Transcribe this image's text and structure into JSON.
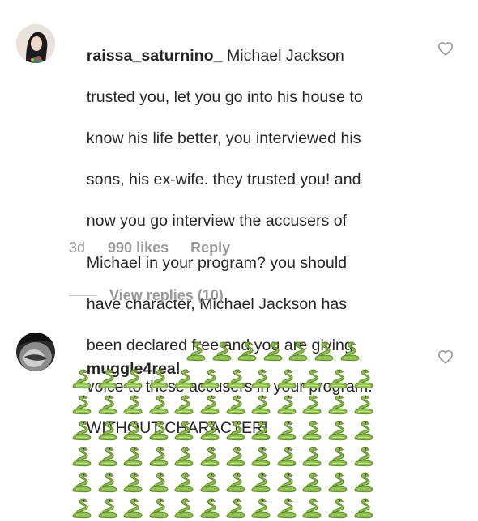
{
  "comments": [
    {
      "username": "raissa_saturnino_",
      "text_lines": [
        " Michael Jackson",
        "trusted you, let you go into his house to",
        "know his life better, you interviewed his",
        "sons, his ex-wife. they trusted you! and",
        "now you go interview the accusers of",
        "Michael in your program? you should",
        "have character, Michael Jackson has",
        "been declared free and you are giving",
        "voice to these accusers in your program.",
        "WITHOUT CHARACTER!"
      ],
      "time": "3d",
      "likes": "990 likes",
      "reply_label": "Reply",
      "view_replies": "View replies (10)",
      "like_icon": "heart-outline-icon"
    },
    {
      "username": "muggle4real",
      "emoji": "🐍",
      "inline_snake_count": 7,
      "snake_rows": 6,
      "snakes_per_row": 12,
      "like_icon": "heart-outline-icon"
    }
  ],
  "colors": {
    "text": "#262626",
    "secondary": "#999999",
    "divider": "#c7c7c7",
    "snake": "#8bc34a"
  }
}
